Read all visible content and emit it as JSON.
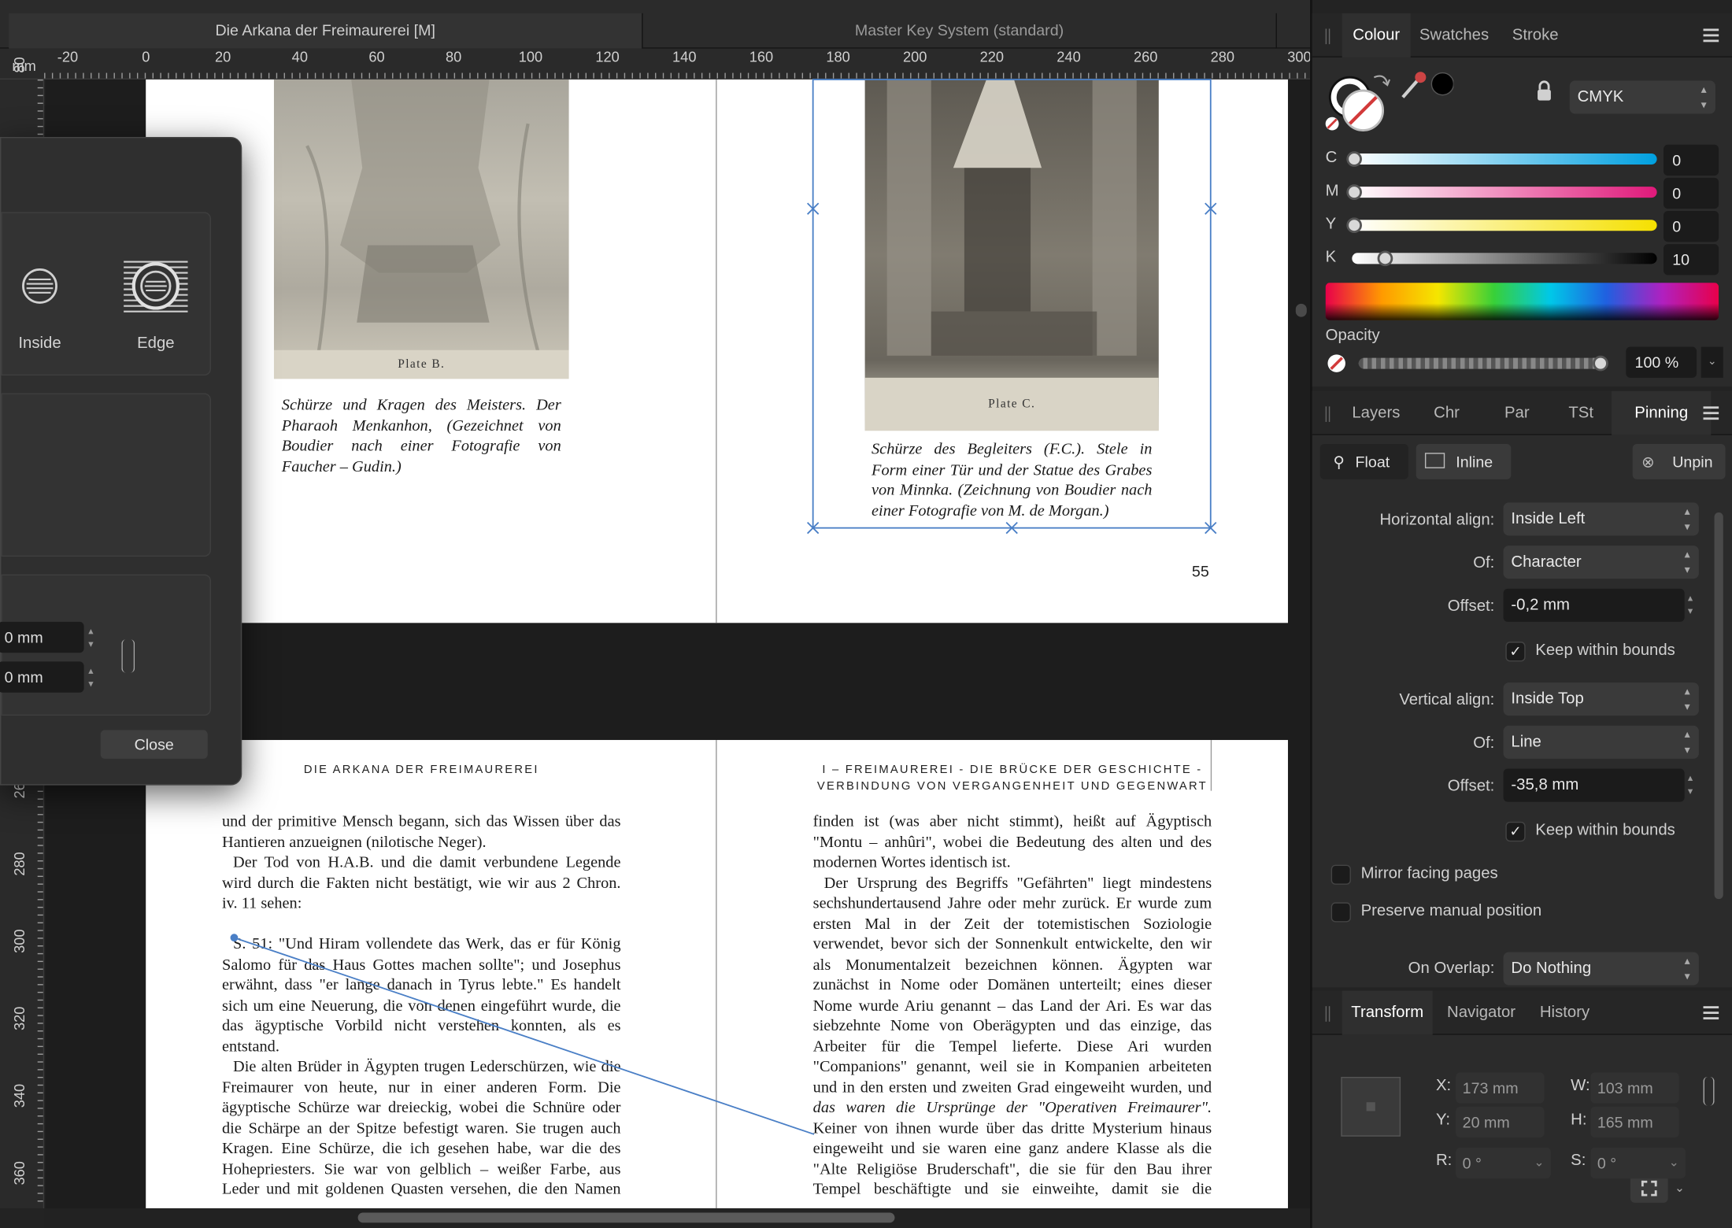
{
  "doc_tabs": [
    {
      "label": "Die Arkana der Freimaurerei [M]",
      "active": true
    },
    {
      "label": "Master Key System (standard)",
      "active": false
    }
  ],
  "ruler": {
    "unit": "mm",
    "h_ticks": [
      "-20",
      "0",
      "20",
      "40",
      "60",
      "80",
      "100",
      "120",
      "140",
      "160",
      "180",
      "200",
      "220",
      "240",
      "260",
      "280",
      "300"
    ],
    "v_ticks": [
      "80",
      "260",
      "280",
      "300",
      "320",
      "340",
      "360"
    ]
  },
  "dialog": {
    "options": [
      {
        "label": "Inside",
        "icon": "stroke-inside-icon"
      },
      {
        "label": "Edge",
        "icon": "stroke-edge-icon"
      }
    ],
    "field1_value": "0 mm",
    "field2_value": "0 mm",
    "close_label": "Close"
  },
  "spread_top": {
    "left_caption_title": "Plate B.",
    "left_caption": "Schürze und Kragen des Meisters. Der Pharaoh Menkanhon, (Gezeichnet von Boudier nach einer Fotografie von Faucher – Gudin.)",
    "right_caption_title": "Plate C.",
    "right_caption": "Schürze des Begleiters (F.C.). Stele in Form einer Tür und der Statue des Grabes von Minnka. (Zeichnung von Boudier nach einer Fotografie von M. de Morgan.)",
    "page_number": "55"
  },
  "spread_bottom": {
    "left_header": "DIE ARKANA DER FREIMAUREREI",
    "right_header_1": "I – FREIMAUREREI - DIE BRÜCKE DER GESCHICHTE -",
    "right_header_2": "VERBINDUNG VON VERGANGENHEIT UND GEGENWART",
    "left_lines": [
      {
        "t": "und der primitive Mensch begann, sich das Wissen über das",
        "j": true
      },
      {
        "t": "Hantieren anzueignen (nilotische Neger).",
        "j": false
      },
      {
        "t": "Der Tod von H.A.B. und die damit verbundene Legende",
        "j": true,
        "indent": true
      },
      {
        "t": "wird durch die Fakten nicht bestätigt, wie wir aus 2 Chron.",
        "j": true
      },
      {
        "t": "iv. 11 sehen:",
        "j": false
      },
      {
        "t": "",
        "j": false
      },
      {
        "t": "S. 51: \"Und Hiram vollendete das Werk, das er für König",
        "j": true,
        "indent": true
      },
      {
        "t": "Salomo für das Haus Gottes machen sollte\"; und Josephus",
        "j": true
      },
      {
        "t": "erwähnt, dass \"er lange danach in Tyrus lebte.\" Es handelt",
        "j": true
      },
      {
        "t": "sich um eine Neuerung, die von denen eingeführt wurde, die",
        "j": true
      },
      {
        "t": "das ägyptische Vorbild nicht verstehen konnten, als es",
        "j": true
      },
      {
        "t": "entstand.",
        "j": false
      },
      {
        "t": "Die alten Brüder in Ägypten trugen Lederschürzen, wie die",
        "j": true,
        "indent": true
      },
      {
        "t": "Freimaurer von heute, nur in einer anderen Form. Die",
        "j": true
      },
      {
        "t": "ägyptische Schürze war dreieckig, wobei die Schnüre oder",
        "j": true
      },
      {
        "t": "die Schärpe an der Spitze befestigt waren. Sie trugen auch",
        "j": true
      },
      {
        "t": "Kragen. Eine Schürze, die ich gesehen habe, war die des",
        "j": true
      },
      {
        "t": "Hohepriesters. Sie war von gelblich – weißer Farbe, aus",
        "j": true
      },
      {
        "t": "Leder und mit goldenen Quasten versehen, die den Namen",
        "j": true
      }
    ],
    "right_lines": [
      {
        "t": "finden ist (was aber nicht stimmt), heißt auf Ägyptisch",
        "j": true
      },
      {
        "t": "\"Montu – anhûri\", wobei die Bedeutung des alten und des",
        "j": true
      },
      {
        "t": "modernen Wortes identisch ist.",
        "j": false
      },
      {
        "t": "Der Ursprung des Begriffs \"Gefährten\" liegt mindestens",
        "j": true,
        "indent": true
      },
      {
        "t": "sechshundertausend Jahre oder mehr zurück. Er wurde zum",
        "j": true
      },
      {
        "t": "ersten Mal in der Zeit der totemistischen Soziologie",
        "j": true
      },
      {
        "t": "verwendet, bevor sich der Sonnenkult entwickelte, den wir",
        "j": true
      },
      {
        "t": "als Monumentalzeit bezeichnen können. Ägypten war",
        "j": true
      },
      {
        "t": "zunächst in Nome oder Domänen unterteilt; eines dieser",
        "j": true
      },
      {
        "t": "Nome wurde Ariu genannt – das Land der Ari. Es war das",
        "j": true
      },
      {
        "t": "siebzehnte Nome von Oberägypten und das einzige, das",
        "j": true
      },
      {
        "t": "Arbeiter für die Tempel lieferte. Diese Ari wurden",
        "j": true
      },
      {
        "t": "\"Companions\" genannt, weil sie in Kompanien arbeiteten",
        "j": true
      },
      {
        "t": "und in den ersten und zweiten Grad eingeweiht wurden, und",
        "j": true
      },
      {
        "t": "das waren die Ursprünge der \"Operativen Freimaurer\".",
        "j": true,
        "italic": true
      },
      {
        "t": "Keiner von ihnen wurde über das dritte Mysterium hinaus",
        "j": true
      },
      {
        "t": "eingeweiht und sie waren eine ganz andere Klasse als die",
        "j": true
      },
      {
        "t": "\"Alte Religiöse Bruderschaft\", die sie für den Bau ihrer",
        "j": true
      },
      {
        "t": "Tempel beschäftigte und sie einweihte, damit sie die",
        "j": true
      }
    ]
  },
  "colour_panel": {
    "tabs": [
      "Colour",
      "Swatches",
      "Stroke"
    ],
    "active_tab": "Colour",
    "model": "CMYK",
    "channels": [
      {
        "label": "C",
        "value": "0",
        "fraction": 0.0,
        "grad": "linear-gradient(90deg,#ffffff,#00a0e0)"
      },
      {
        "label": "M",
        "value": "0",
        "fraction": 0.0,
        "grad": "linear-gradient(90deg,#ffffff,#e0197a)"
      },
      {
        "label": "Y",
        "value": "0",
        "fraction": 0.0,
        "grad": "linear-gradient(90deg,#ffffff,#f5e000)"
      },
      {
        "label": "K",
        "value": "10",
        "fraction": 0.1,
        "grad": "linear-gradient(90deg,#ffffff,#000000)"
      }
    ],
    "opacity_label": "Opacity",
    "opacity_value": "100 %",
    "opacity_fraction": 1.0
  },
  "pinning_panel": {
    "tabs": [
      "Layers",
      "Chr",
      "Par",
      "TSt",
      "Pinning"
    ],
    "active_tab": "Pinning",
    "modes": [
      "Float",
      "Inline"
    ],
    "unpin_label": "Unpin",
    "rows": [
      {
        "label": "Horizontal align:",
        "type": "combo",
        "value": "Inside Left"
      },
      {
        "label": "Of:",
        "type": "combo",
        "value": "Character"
      },
      {
        "label": "Offset:",
        "type": "input",
        "value": "-0,2 mm"
      },
      {
        "label": "",
        "type": "check",
        "value": "Keep within bounds",
        "checked": true
      },
      {
        "label": "Vertical align:",
        "type": "combo",
        "value": "Inside Top"
      },
      {
        "label": "Of:",
        "type": "combo",
        "value": "Line"
      },
      {
        "label": "Offset:",
        "type": "input",
        "value": "-35,8 mm"
      },
      {
        "label": "",
        "type": "check",
        "value": "Keep within bounds",
        "checked": true
      }
    ],
    "mirror_label": "Mirror facing pages",
    "preserve_label": "Preserve manual position",
    "overlap_label": "On Overlap:",
    "overlap_value": "Do Nothing"
  },
  "transform_panel": {
    "tabs": [
      "Transform",
      "Navigator",
      "History"
    ],
    "active_tab": "Transform",
    "fields": [
      {
        "label": "X:",
        "value": "173 mm"
      },
      {
        "label": "W:",
        "value": "103 mm"
      },
      {
        "label": "Y:",
        "value": "20 mm"
      },
      {
        "label": "H:",
        "value": "165 mm"
      },
      {
        "label": "R:",
        "value": "0 °"
      },
      {
        "label": "S:",
        "value": "0 °"
      }
    ]
  }
}
